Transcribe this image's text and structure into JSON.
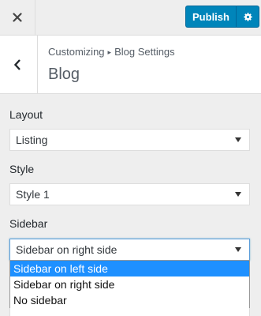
{
  "header": {
    "close_icon": "close-icon",
    "publish_label": "Publish",
    "settings_icon": "gear-icon",
    "accent": "#0085ba"
  },
  "section": {
    "breadcrumb_parent": "Customizing",
    "breadcrumb_sep": "▸",
    "breadcrumb_current": "Blog Settings",
    "title": "Blog",
    "back_icon": "chevron-left-icon"
  },
  "controls": {
    "layout": {
      "label": "Layout",
      "value": "Listing"
    },
    "style": {
      "label": "Style",
      "value": "Style 1"
    },
    "sidebar": {
      "label": "Sidebar",
      "value": "Sidebar on right side",
      "options": [
        "Sidebar on left side",
        "Sidebar on right side",
        "No sidebar"
      ],
      "highlighted_index": 0
    }
  }
}
